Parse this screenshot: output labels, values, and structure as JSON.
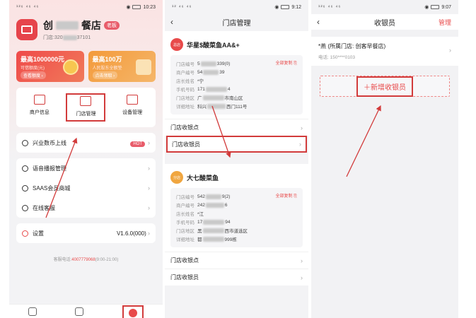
{
  "statusbars": {
    "p1": {
      "left": "¹²⁶ ⁴⁶ ⁴⁶",
      "right": "10:23"
    },
    "p2": {
      "left": "¹² ⁴⁶ ⁴⁶",
      "right": "9:12"
    },
    "p3": {
      "left": "¹²⁶ ⁴⁶ ⁴⁶",
      "right": "9:07"
    }
  },
  "p1": {
    "store_name_a": "创",
    "store_name_b": "餐店",
    "store_tag": "老板",
    "store_id_prefix": "门店:",
    "store_id_a": "320",
    "store_id_b": "37101",
    "promo": [
      {
        "title": "最高1000000元",
        "sub": "可借额度(元)",
        "btn": "查看额度 ›"
      },
      {
        "title": "最高100万",
        "sub": "人民股东全额垫",
        "btn": "点击领取 ›"
      }
    ],
    "grid": [
      {
        "label": "商户信息"
      },
      {
        "label": "门店管理"
      },
      {
        "label": "设备管理"
      }
    ],
    "rows1": [
      {
        "label": "兴业数币上线",
        "badge": "HOT"
      }
    ],
    "rows2": [
      {
        "label": "语音播报管理"
      },
      {
        "label": "SAAS会员商城"
      },
      {
        "label": "在线客服"
      }
    ],
    "settings": {
      "label": "设置",
      "value": "V1.6.0(000)"
    },
    "hotline": {
      "label": "客服电话:",
      "number": "4007779068",
      "hours": "(9:00-21:00)"
    }
  },
  "p2": {
    "title": "门店管理",
    "stores": [
      {
        "badge": "总店",
        "name": "华星$酸菜鱼AA&+",
        "copy": "全部复制 ⎘",
        "fields": [
          {
            "k": "门店编号",
            "v": "5",
            "v2": "339(0)"
          },
          {
            "k": "商户编号",
            "v": "54",
            "v2": "39"
          },
          {
            "k": "店长姓名",
            "v": "*宁",
            "v2": ""
          },
          {
            "k": "手机号码",
            "v": "171",
            "v2": "4"
          },
          {
            "k": "门店地区",
            "v": "广",
            "v2": "市南山区"
          },
          {
            "k": "详细地址",
            "v": "科兴",
            "v2": "西门111号"
          }
        ],
        "links": [
          "门店收银点",
          "门店收银员"
        ]
      },
      {
        "badge": "分店",
        "name": "大七酸菜鱼",
        "copy": "全部复制 ⎘",
        "fields": [
          {
            "k": "门店编号",
            "v": "542",
            "v2": "9(2)"
          },
          {
            "k": "商户编号",
            "v": "242",
            "v2": "6"
          },
          {
            "k": "店长姓名",
            "v": "*江",
            "v2": ""
          },
          {
            "k": "手机号码",
            "v": "17",
            "v2": "94"
          },
          {
            "k": "门店地区",
            "v": "黑",
            "v2": "西市道选区"
          },
          {
            "k": "详细地址",
            "v": "都",
            "v2": "999栋"
          }
        ],
        "links": [
          "门店收银点",
          "门店收银员"
        ]
      }
    ]
  },
  "p3": {
    "title": "收银员",
    "manage": "管理",
    "cashier_name": "*燕  (所属门店: 创客早餐店)",
    "cashier_phone": "电话: 150****0103",
    "add_label": "＋新增收银员"
  }
}
